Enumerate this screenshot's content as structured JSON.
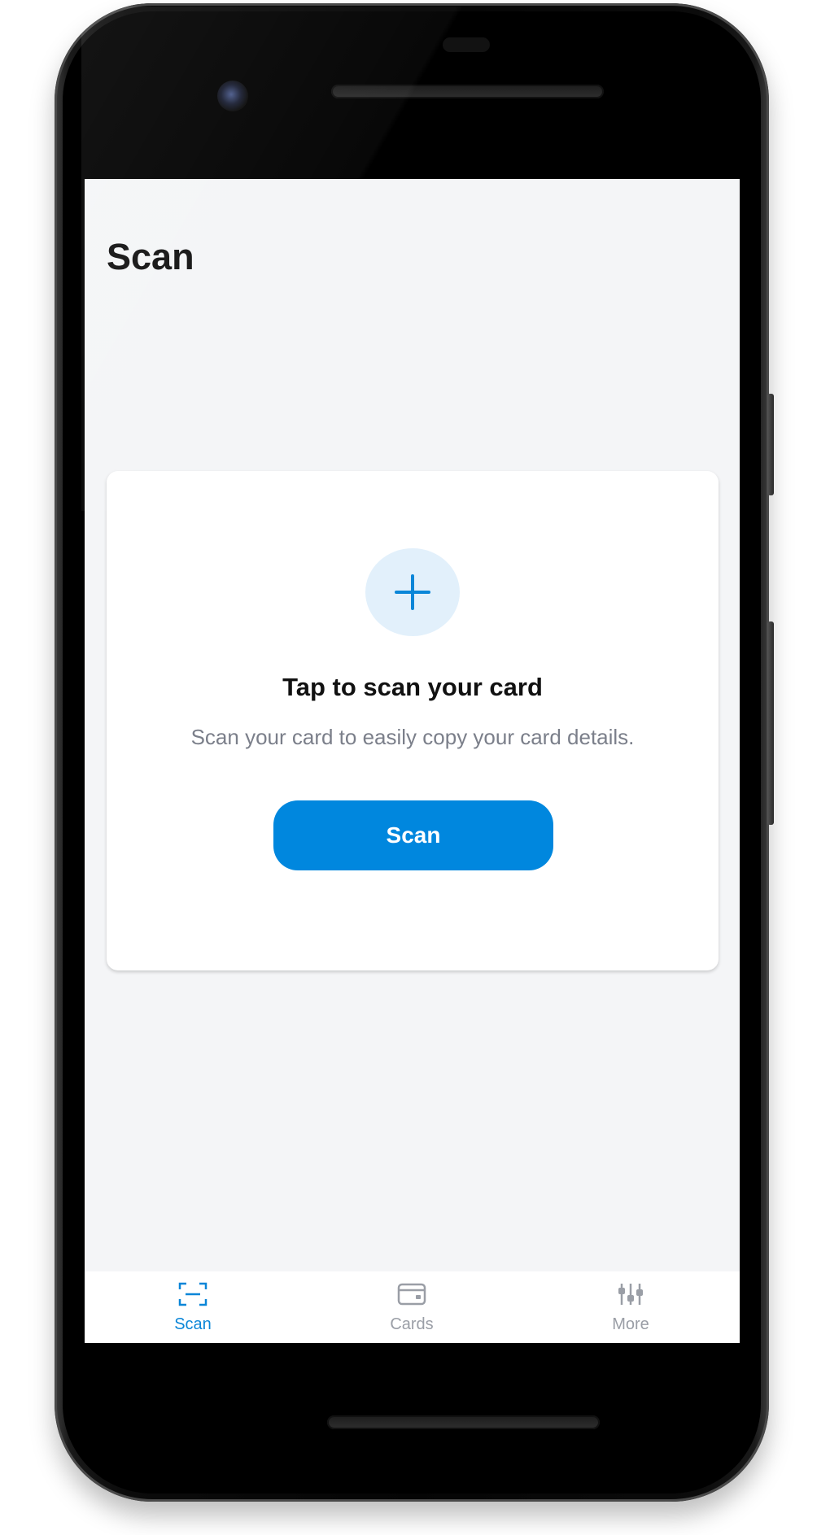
{
  "screen": {
    "title": "Scan"
  },
  "scan_card": {
    "heading": "Tap to scan your card",
    "subtitle": "Scan your card to easily copy your card details.",
    "button_label": "Scan"
  },
  "bottom_nav": {
    "items": [
      {
        "label": "Scan",
        "icon": "scan-frame-icon",
        "active": true
      },
      {
        "label": "Cards",
        "icon": "card-icon",
        "active": false
      },
      {
        "label": "More",
        "icon": "sliders-icon",
        "active": false
      }
    ]
  },
  "colors": {
    "accent": "#0087de",
    "accent_light": "#e2f0fb",
    "active_tab": "#0a86d8",
    "inactive_tab": "#9a9ea6",
    "screen_background": "#f4f5f7",
    "phone_body": "#0b0b0b"
  }
}
